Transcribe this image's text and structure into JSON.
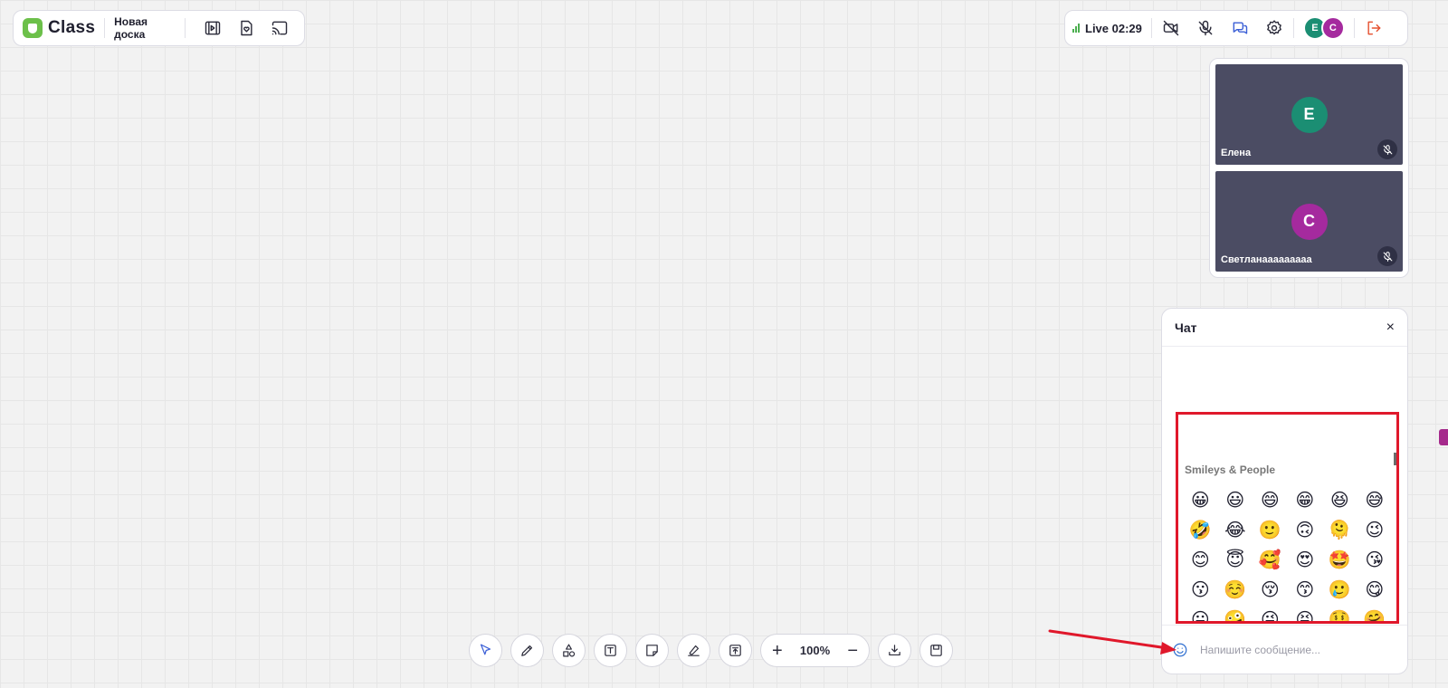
{
  "app": {
    "logo_text": "Class",
    "board_name": "Новая доска"
  },
  "status": {
    "live_text": "Live 02:29"
  },
  "colors": {
    "accent_green": "#6cc04a",
    "participant_e": "#1b8e73",
    "participant_c": "#a52a9e",
    "annotation_red": "#e0182b",
    "leave_red": "#e5502f"
  },
  "participants": [
    {
      "initial": "Е",
      "name": "Елена",
      "color": "#1b8e73"
    },
    {
      "initial": "С",
      "name": "Светланааааааааа",
      "color": "#a52a9e"
    }
  ],
  "header_avatars": [
    {
      "initial": "E",
      "color": "#1b8e73"
    },
    {
      "initial": "C",
      "color": "#a52a9e"
    }
  ],
  "chat": {
    "title": "Чат",
    "close_label": "×",
    "input_placeholder": "Напишите сообщение...",
    "emoji_category": "Smileys & People",
    "emojis": [
      "😀",
      "😃",
      "😄",
      "😁",
      "😆",
      "😅",
      "🤣",
      "😂",
      "🙂",
      "🙃",
      "🫠",
      "😉",
      "😊",
      "😇",
      "🥰",
      "😍",
      "🤩",
      "😘",
      "😗",
      "☺️",
      "😚",
      "😙",
      "🥲",
      "😋",
      "😛",
      "🤪",
      "😜",
      "😝",
      "🤑",
      "🤗"
    ]
  },
  "zoom": {
    "level": "100%",
    "plus": "+",
    "minus": "−"
  },
  "icons": {
    "top_left": [
      "video-library-icon",
      "heart-document-icon",
      "cast-icon"
    ],
    "top_right": [
      "camera-off-icon",
      "mic-off-icon",
      "chat-icon",
      "gear-icon",
      "leave-icon"
    ],
    "toolbar": [
      "select-pointer-icon",
      "pencil-icon",
      "shapes-icon",
      "text-icon",
      "sticky-note-icon",
      "eraser-icon",
      "upload-icon",
      "download-icon",
      "save-icon"
    ]
  }
}
